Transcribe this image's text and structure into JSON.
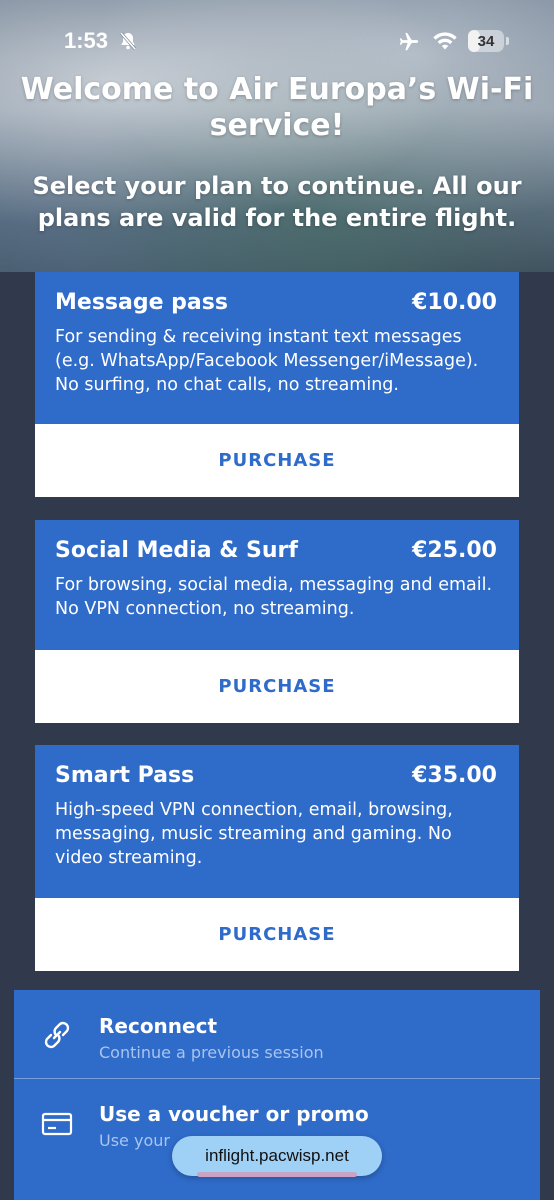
{
  "status": {
    "time": "1:53",
    "battery": "34",
    "battery_level": 0.34
  },
  "hero": {
    "title": "Welcome to Air Europa’s Wi-Fi service!",
    "subtitle": "Select your plan to continue. All our plans are valid for the entire flight."
  },
  "plans": [
    {
      "name": "Message pass",
      "price": "€10.00",
      "description": "For sending & receiving instant text messages (e.g. WhatsApp/Facebook Messenger/iMessage). No surfing, no chat calls, no streaming.",
      "button": "PURCHASE"
    },
    {
      "name": "Social Media & Surf",
      "price": "€25.00",
      "description": "For browsing, social media, messaging and email. No VPN connection, no streaming.",
      "button": "PURCHASE"
    },
    {
      "name": "Smart Pass",
      "price": "€35.00",
      "description": "High-speed VPN connection, email, browsing, messaging, music streaming and gaming. No video streaming.",
      "button": "PURCHASE"
    }
  ],
  "options": {
    "reconnect": {
      "title": "Reconnect",
      "subtitle": "Continue a previous session",
      "icon": "link-icon"
    },
    "voucher": {
      "title": "Use a voucher or promo",
      "subtitle": "Use your",
      "icon": "card-icon"
    }
  },
  "browser": {
    "url": "inflight.pacwisp.net"
  },
  "colors": {
    "accent": "#2f6bc9",
    "background": "#313a4c"
  }
}
